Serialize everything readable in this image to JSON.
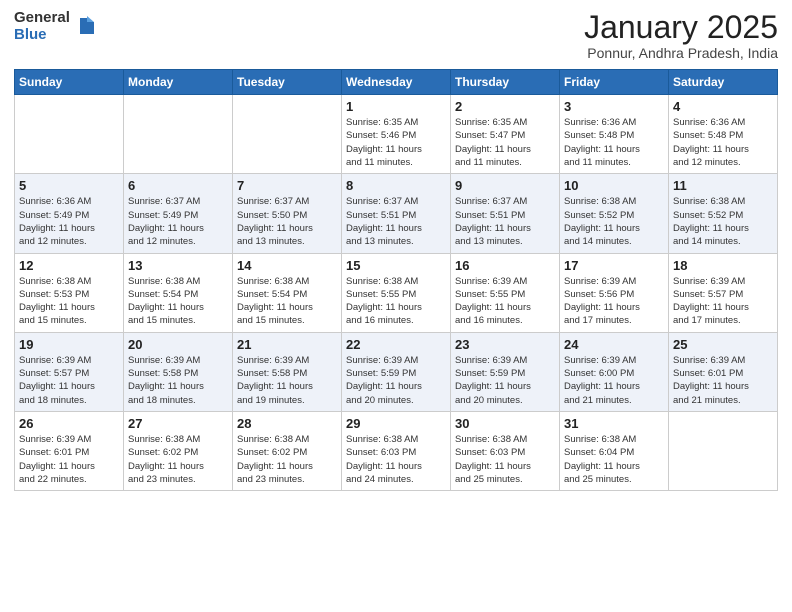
{
  "header": {
    "logo_general": "General",
    "logo_blue": "Blue",
    "month_title": "January 2025",
    "location": "Ponnur, Andhra Pradesh, India"
  },
  "days_of_week": [
    "Sunday",
    "Monday",
    "Tuesday",
    "Wednesday",
    "Thursday",
    "Friday",
    "Saturday"
  ],
  "weeks": [
    [
      {
        "day": "",
        "info": ""
      },
      {
        "day": "",
        "info": ""
      },
      {
        "day": "",
        "info": ""
      },
      {
        "day": "1",
        "info": "Sunrise: 6:35 AM\nSunset: 5:46 PM\nDaylight: 11 hours\nand 11 minutes."
      },
      {
        "day": "2",
        "info": "Sunrise: 6:35 AM\nSunset: 5:47 PM\nDaylight: 11 hours\nand 11 minutes."
      },
      {
        "day": "3",
        "info": "Sunrise: 6:36 AM\nSunset: 5:48 PM\nDaylight: 11 hours\nand 11 minutes."
      },
      {
        "day": "4",
        "info": "Sunrise: 6:36 AM\nSunset: 5:48 PM\nDaylight: 11 hours\nand 12 minutes."
      }
    ],
    [
      {
        "day": "5",
        "info": "Sunrise: 6:36 AM\nSunset: 5:49 PM\nDaylight: 11 hours\nand 12 minutes."
      },
      {
        "day": "6",
        "info": "Sunrise: 6:37 AM\nSunset: 5:49 PM\nDaylight: 11 hours\nand 12 minutes."
      },
      {
        "day": "7",
        "info": "Sunrise: 6:37 AM\nSunset: 5:50 PM\nDaylight: 11 hours\nand 13 minutes."
      },
      {
        "day": "8",
        "info": "Sunrise: 6:37 AM\nSunset: 5:51 PM\nDaylight: 11 hours\nand 13 minutes."
      },
      {
        "day": "9",
        "info": "Sunrise: 6:37 AM\nSunset: 5:51 PM\nDaylight: 11 hours\nand 13 minutes."
      },
      {
        "day": "10",
        "info": "Sunrise: 6:38 AM\nSunset: 5:52 PM\nDaylight: 11 hours\nand 14 minutes."
      },
      {
        "day": "11",
        "info": "Sunrise: 6:38 AM\nSunset: 5:52 PM\nDaylight: 11 hours\nand 14 minutes."
      }
    ],
    [
      {
        "day": "12",
        "info": "Sunrise: 6:38 AM\nSunset: 5:53 PM\nDaylight: 11 hours\nand 15 minutes."
      },
      {
        "day": "13",
        "info": "Sunrise: 6:38 AM\nSunset: 5:54 PM\nDaylight: 11 hours\nand 15 minutes."
      },
      {
        "day": "14",
        "info": "Sunrise: 6:38 AM\nSunset: 5:54 PM\nDaylight: 11 hours\nand 15 minutes."
      },
      {
        "day": "15",
        "info": "Sunrise: 6:38 AM\nSunset: 5:55 PM\nDaylight: 11 hours\nand 16 minutes."
      },
      {
        "day": "16",
        "info": "Sunrise: 6:39 AM\nSunset: 5:55 PM\nDaylight: 11 hours\nand 16 minutes."
      },
      {
        "day": "17",
        "info": "Sunrise: 6:39 AM\nSunset: 5:56 PM\nDaylight: 11 hours\nand 17 minutes."
      },
      {
        "day": "18",
        "info": "Sunrise: 6:39 AM\nSunset: 5:57 PM\nDaylight: 11 hours\nand 17 minutes."
      }
    ],
    [
      {
        "day": "19",
        "info": "Sunrise: 6:39 AM\nSunset: 5:57 PM\nDaylight: 11 hours\nand 18 minutes."
      },
      {
        "day": "20",
        "info": "Sunrise: 6:39 AM\nSunset: 5:58 PM\nDaylight: 11 hours\nand 18 minutes."
      },
      {
        "day": "21",
        "info": "Sunrise: 6:39 AM\nSunset: 5:58 PM\nDaylight: 11 hours\nand 19 minutes."
      },
      {
        "day": "22",
        "info": "Sunrise: 6:39 AM\nSunset: 5:59 PM\nDaylight: 11 hours\nand 20 minutes."
      },
      {
        "day": "23",
        "info": "Sunrise: 6:39 AM\nSunset: 5:59 PM\nDaylight: 11 hours\nand 20 minutes."
      },
      {
        "day": "24",
        "info": "Sunrise: 6:39 AM\nSunset: 6:00 PM\nDaylight: 11 hours\nand 21 minutes."
      },
      {
        "day": "25",
        "info": "Sunrise: 6:39 AM\nSunset: 6:01 PM\nDaylight: 11 hours\nand 21 minutes."
      }
    ],
    [
      {
        "day": "26",
        "info": "Sunrise: 6:39 AM\nSunset: 6:01 PM\nDaylight: 11 hours\nand 22 minutes."
      },
      {
        "day": "27",
        "info": "Sunrise: 6:38 AM\nSunset: 6:02 PM\nDaylight: 11 hours\nand 23 minutes."
      },
      {
        "day": "28",
        "info": "Sunrise: 6:38 AM\nSunset: 6:02 PM\nDaylight: 11 hours\nand 23 minutes."
      },
      {
        "day": "29",
        "info": "Sunrise: 6:38 AM\nSunset: 6:03 PM\nDaylight: 11 hours\nand 24 minutes."
      },
      {
        "day": "30",
        "info": "Sunrise: 6:38 AM\nSunset: 6:03 PM\nDaylight: 11 hours\nand 25 minutes."
      },
      {
        "day": "31",
        "info": "Sunrise: 6:38 AM\nSunset: 6:04 PM\nDaylight: 11 hours\nand 25 minutes."
      },
      {
        "day": "",
        "info": ""
      }
    ]
  ]
}
